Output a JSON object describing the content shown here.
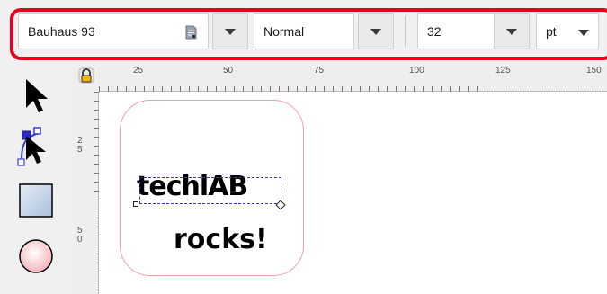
{
  "toolbar": {
    "font_family": "Bauhaus 93",
    "font_style": "Normal",
    "font_size": "32",
    "unit": "pt",
    "highlight_color": "#e8001c"
  },
  "toolbox": {
    "tools": [
      {
        "name": "selector-tool",
        "icon": "arrow-pointer-icon"
      },
      {
        "name": "node-tool",
        "icon": "node-editor-icon"
      },
      {
        "name": "rectangle-tool",
        "icon": "square-icon"
      },
      {
        "name": "ellipse-tool",
        "icon": "circle-icon"
      }
    ]
  },
  "ruler": {
    "horizontal_labels": [
      "25",
      "50",
      "75",
      "100",
      "125",
      "150"
    ],
    "vertical_labels": [
      "25",
      "50"
    ]
  },
  "canvas": {
    "line1": "techlAB",
    "line2": "rocks!"
  }
}
